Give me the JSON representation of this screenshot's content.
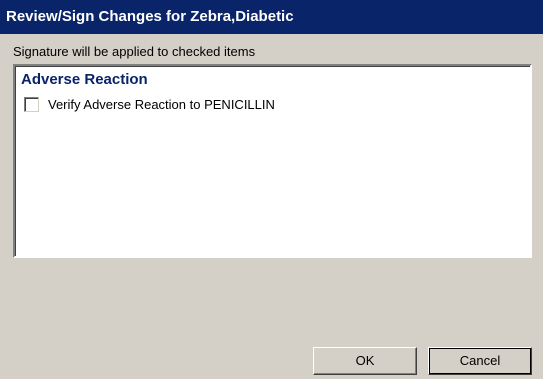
{
  "window": {
    "title": "Review/Sign Changes for Zebra,Diabetic"
  },
  "instruction": "Signature will be applied to checked items",
  "list": {
    "group_header": "Adverse Reaction",
    "items": [
      {
        "label": "Verify Adverse Reaction to PENICILLIN",
        "checked": false
      }
    ]
  },
  "buttons": {
    "ok_label": "OK",
    "cancel_label": "Cancel"
  },
  "colors": {
    "titlebar": "#0a246a",
    "window_bg": "#d4d0c8",
    "group_header": "#0a246a"
  }
}
